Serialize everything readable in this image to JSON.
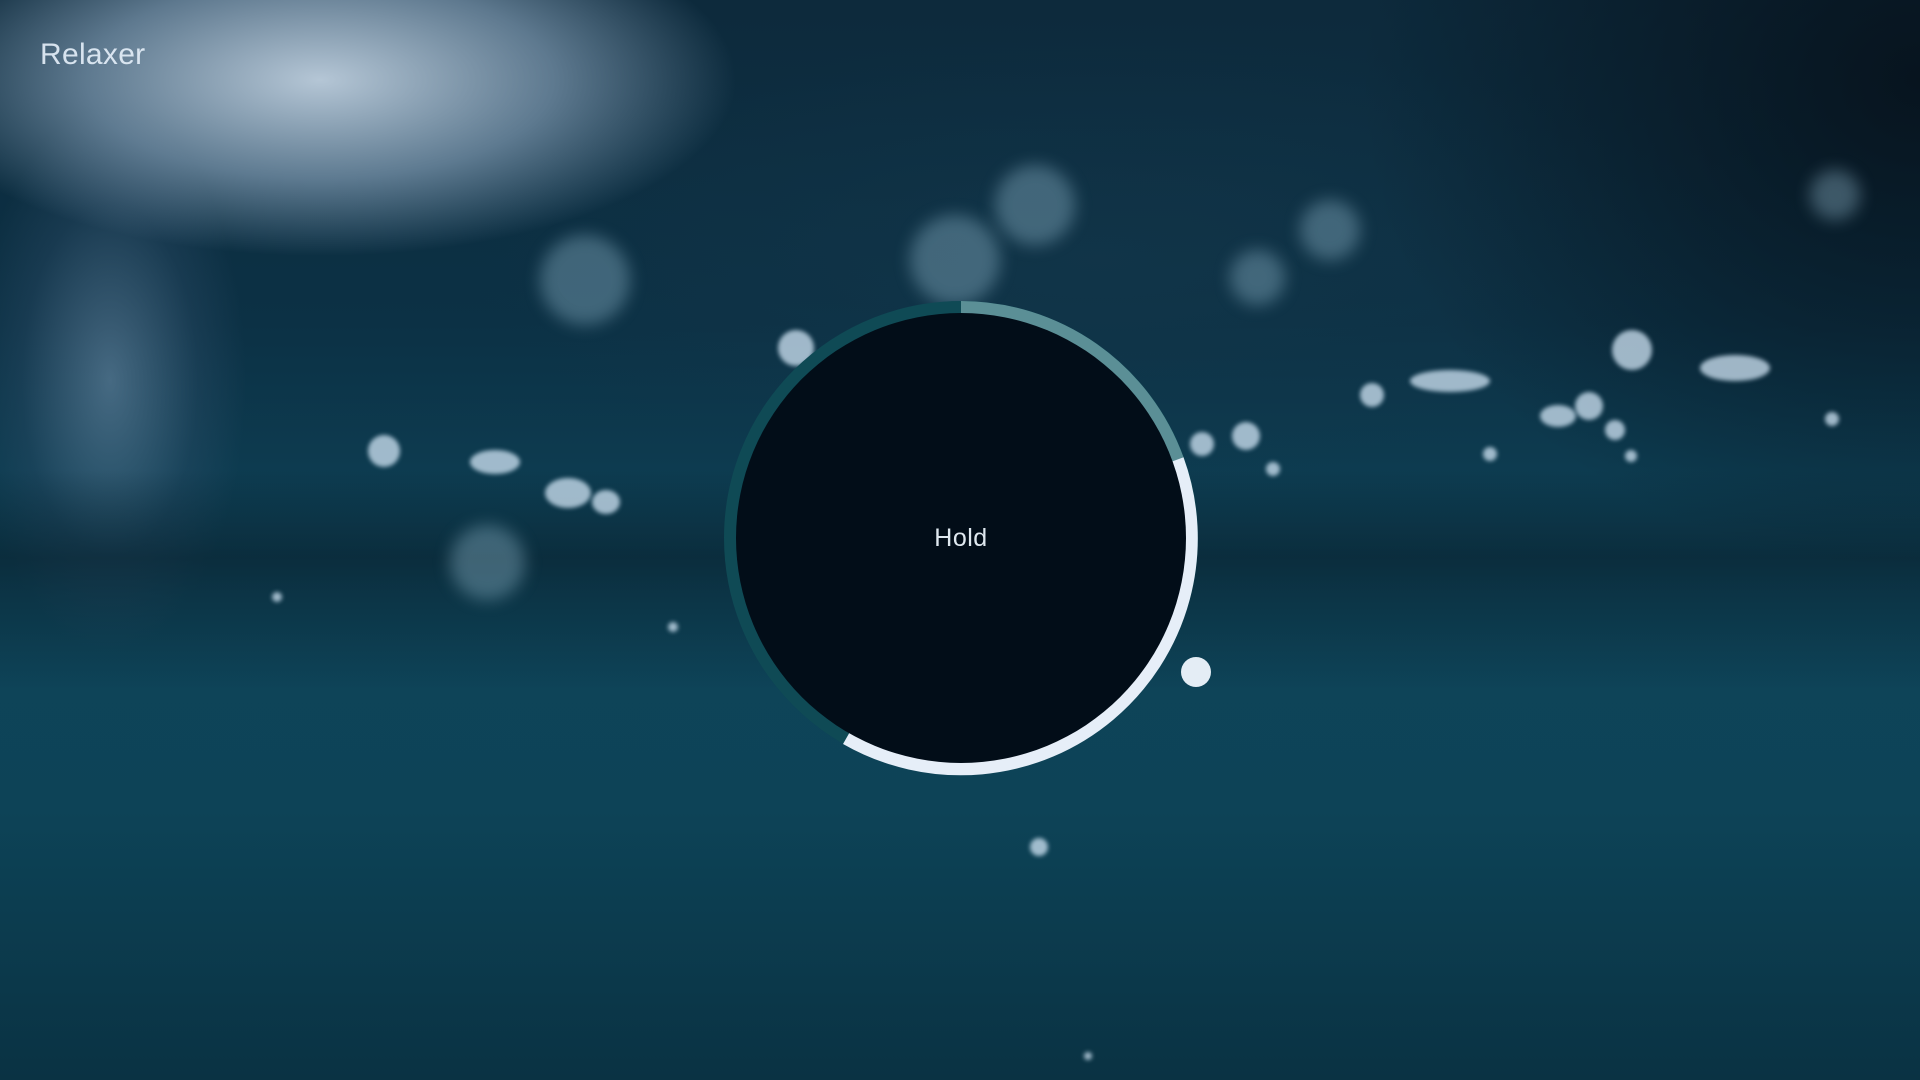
{
  "app": {
    "title": "Relaxer"
  },
  "breathing": {
    "phase_label": "Hold"
  },
  "colors": {
    "ring_track": "#0f4a55",
    "ring_segment_light": "#e6eef8",
    "ring_segment_mid": "#5b8f96",
    "circle_fill": "#020d18"
  }
}
